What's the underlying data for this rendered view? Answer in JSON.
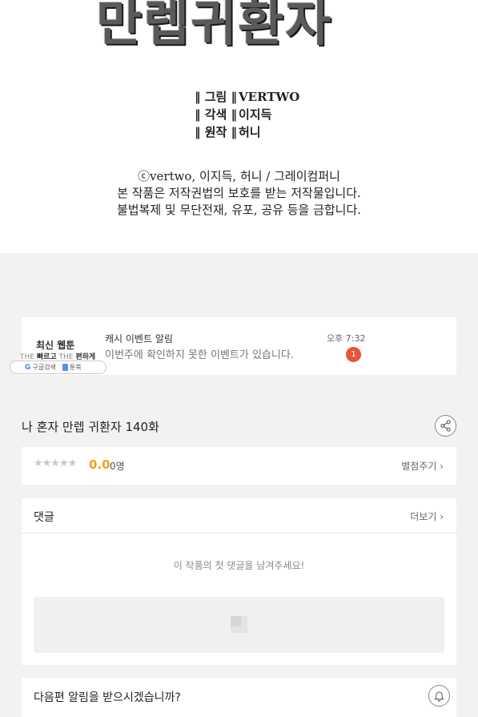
{
  "comic": {
    "logo_text": "만렙귀환자",
    "credits": [
      {
        "role": "‖ 그림 ‖",
        "name": "VERTWO"
      },
      {
        "role": "‖ 각색 ‖",
        "name": "이지득"
      },
      {
        "role": "‖ 원작 ‖",
        "name": "허니"
      }
    ],
    "copyright_lines": [
      "ⓒvertwo, 이지득, 허니 / 그레이컴퍼니",
      "본 작품은 저작권법의 보호를 받는 저작물입니다.",
      "불법복제 및 무단전재, 유포, 공유 등을 금합니다."
    ]
  },
  "ad": {
    "brand": "최신 웹툰",
    "sub_the1": "THE",
    "sub_fast": "빠르고",
    "sub_the2": "THE",
    "sub_easy": "편하게",
    "search_label": "구글검색",
    "app_label": "툰북",
    "title": "캐시 이벤트 알림",
    "message": "이번주에 확인하지 못한 이벤트가 있습니다.",
    "time": "오후 7:32",
    "badge_count": "1"
  },
  "episode": {
    "title": "나 혼자 만렙 귀환자 140화"
  },
  "rating": {
    "stars": "★★★★★",
    "score": "0.0",
    "voters": "0명",
    "rate_label": "별점주기 ›"
  },
  "comments": {
    "label": "댓글",
    "more_label": "더보기 ›",
    "empty_text": "이 작품의 첫 댓글을 남겨주세요!"
  },
  "notify": {
    "text": "다음편 알림을 받으시겠습니까?"
  },
  "colors": {
    "accent_score": "#f2a01e",
    "badge": "#e8543a",
    "background": "#f2f2f2"
  }
}
